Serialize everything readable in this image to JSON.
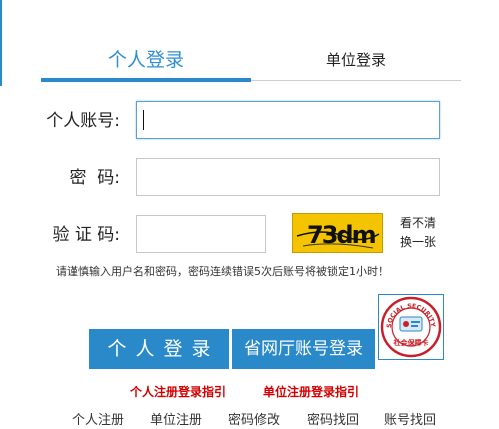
{
  "tabs": {
    "personal": "个人登录",
    "unit": "单位登录"
  },
  "form": {
    "account_label": "个人账号:",
    "password_label": "密  码:",
    "captcha_label": "验 证 码:",
    "captcha_text": "73dm",
    "captcha_refresh_line1": "看不清",
    "captcha_refresh_line2": "换一张"
  },
  "notice": "请谨慎输入用户名和密码，密码连续错误5次后账号将被锁定1小时！",
  "buttons": {
    "login": "个人登录",
    "province": "省网厅账号登录"
  },
  "seal": {
    "ring_text": "SOCIAL SECURITY CARD",
    "bottom_text": "社会保障卡"
  },
  "guides": {
    "personal": "个人注册登录指引",
    "unit": "单位注册登录指引"
  },
  "bottom_links": [
    "个人注册",
    "单位注册",
    "密码修改",
    "密码找回",
    "账号找回"
  ],
  "colors": {
    "primary": "#2a8ac9",
    "guide_red": "#d40000",
    "captcha_bg": "#f5c400"
  }
}
